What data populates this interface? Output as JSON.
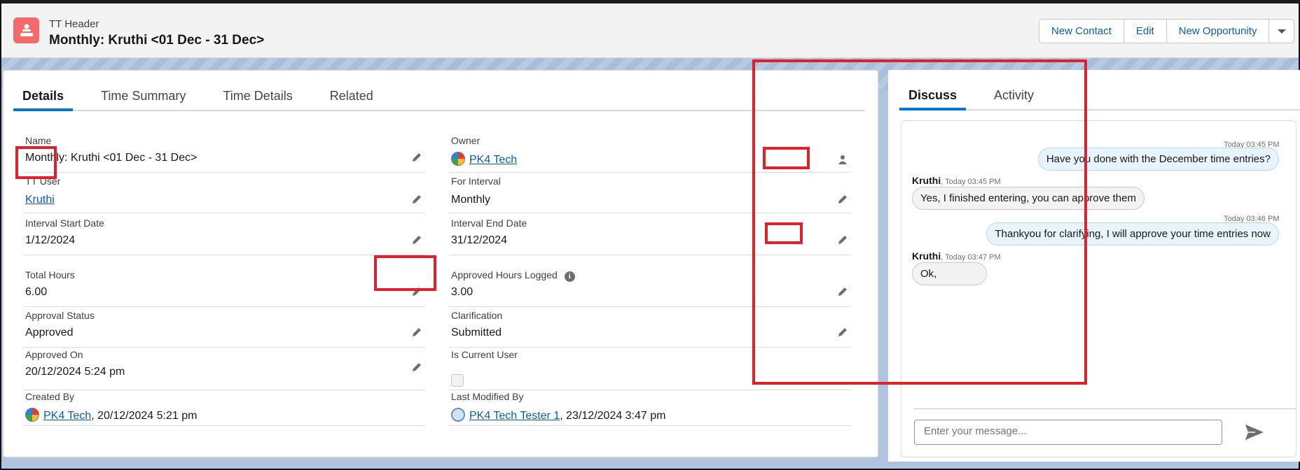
{
  "header": {
    "eyebrow": "TT Header",
    "title": "Monthly: Kruthi <01 Dec - 31 Dec>",
    "actions": [
      "New Contact",
      "Edit",
      "New Opportunity"
    ],
    "icon": "record-icon"
  },
  "left_tabs": [
    "Details",
    "Time Summary",
    "Time Details",
    "Related"
  ],
  "active_left_tab": "Details",
  "fields": {
    "name": {
      "label": "Name",
      "value": "Monthly: Kruthi <01 Dec - 31 Dec>"
    },
    "owner": {
      "label": "Owner",
      "value": "PK4 Tech"
    },
    "tt_user": {
      "label": "TT User",
      "value": "Kruthi"
    },
    "for_interval": {
      "label": "For Interval",
      "value": "Monthly"
    },
    "interval_start": {
      "label": "Interval Start Date",
      "value": "1/12/2024"
    },
    "interval_end": {
      "label": "Interval End Date",
      "value": "31/12/2024"
    },
    "total_hours": {
      "label": "Total Hours",
      "value": "6.00"
    },
    "approved_hours": {
      "label": "Approved Hours Logged",
      "value": "3.00"
    },
    "approval_status": {
      "label": "Approval Status",
      "value": "Approved"
    },
    "clarification": {
      "label": "Clarification",
      "value": "Submitted"
    },
    "approved_on": {
      "label": "Approved On",
      "value": "20/12/2024 5:24 pm"
    },
    "is_current_user": {
      "label": "Is Current User",
      "value": false
    },
    "created_by": {
      "label": "Created By",
      "user": "PK4 Tech",
      "date": ", 20/12/2024 5:21 pm"
    },
    "last_modified_by": {
      "label": "Last Modified By",
      "user": "PK4 Tech Tester 1",
      "date": ", 23/12/2024 3:47 pm"
    }
  },
  "right_tabs": [
    "Discuss",
    "Activity"
  ],
  "active_right_tab": "Discuss",
  "chat": {
    "messages": [
      {
        "direction": "out",
        "time": "Today 03:45 PM",
        "text": "Have you done with the December time entries?"
      },
      {
        "direction": "in",
        "sender": "Kruthi",
        "time": ", Today 03:45 PM",
        "text": "Yes, I finished entering, you can approve them"
      },
      {
        "direction": "out",
        "time": "Today 03:46 PM",
        "text": "Thankyou for clarifying, I will approve your time entries now"
      },
      {
        "direction": "in",
        "sender": "Kruthi",
        "time": ", Today 03:47 PM",
        "text": "Ok,"
      }
    ],
    "composer_placeholder": "Enter your message..."
  },
  "colors": {
    "accent": "#0176d3",
    "link": "#0b5cab",
    "highlight": "#e0202a",
    "header_icon": "#f26a6a"
  }
}
